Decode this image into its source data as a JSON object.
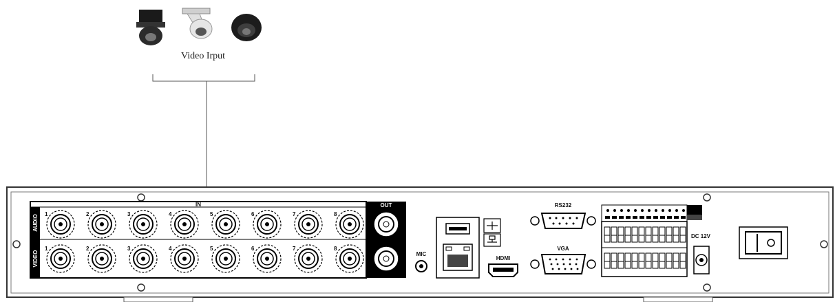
{
  "video_input_label": "Video Irput",
  "cameras": [
    {
      "name": "speed-dome-camera"
    },
    {
      "name": "pan-tilt-camera"
    },
    {
      "name": "dome-camera"
    }
  ],
  "panel": {
    "in_label": "IN",
    "out_label": "OUT",
    "audio_label": "AUDIO",
    "video_label": "VIDEO",
    "mic_label": "MIC",
    "hdmi_label": "HDMI",
    "rs232_label": "RS232",
    "vga_label": "VGA",
    "dc_label": "DC 12V",
    "channel_numbers": [
      "1",
      "2",
      "3",
      "4",
      "5",
      "6",
      "7",
      "8"
    ]
  }
}
